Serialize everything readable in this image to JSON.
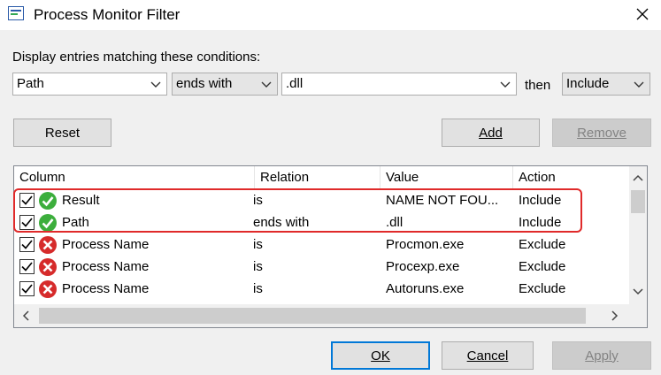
{
  "window": {
    "title": "Process Monitor Filter"
  },
  "filter": {
    "prompt": "Display entries matching these conditions:",
    "column": "Path",
    "relation": "ends with",
    "value": ".dll",
    "then_label": "then",
    "action": "Include"
  },
  "buttons": {
    "reset": "Reset",
    "add": "Add",
    "remove": "Remove",
    "ok": "OK",
    "cancel": "Cancel",
    "apply": "Apply"
  },
  "table": {
    "headers": [
      "Column",
      "Relation",
      "Value",
      "Action"
    ],
    "rows": [
      {
        "checked": true,
        "status": "include",
        "column": "Result",
        "relation": "is",
        "value": "NAME NOT FOU...",
        "action": "Include"
      },
      {
        "checked": true,
        "status": "include",
        "column": "Path",
        "relation": "ends with",
        "value": ".dll",
        "action": "Include"
      },
      {
        "checked": true,
        "status": "exclude",
        "column": "Process Name",
        "relation": "is",
        "value": "Procmon.exe",
        "action": "Exclude"
      },
      {
        "checked": true,
        "status": "exclude",
        "column": "Process Name",
        "relation": "is",
        "value": "Procexp.exe",
        "action": "Exclude"
      },
      {
        "checked": true,
        "status": "exclude",
        "column": "Process Name",
        "relation": "is",
        "value": "Autoruns.exe",
        "action": "Exclude"
      }
    ]
  },
  "colors": {
    "accent": "#0078d7",
    "highlight": "#e02a2a",
    "include_icon": "#3cae3c",
    "exclude_icon": "#d62b2b"
  }
}
